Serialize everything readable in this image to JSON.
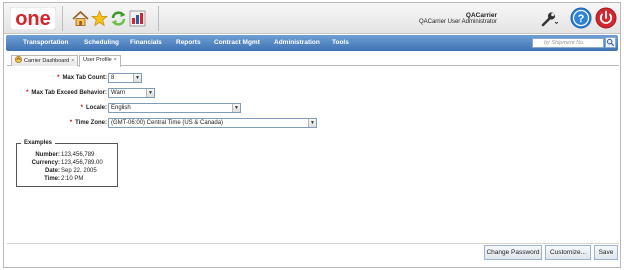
{
  "header": {
    "logo_text": "one",
    "user_name": "QACarrier",
    "user_role": "QACarrier User Administrator"
  },
  "nav": {
    "items": [
      "Transportation",
      "Scheduling",
      "Financials",
      "Reports",
      "Contract Mgmt",
      "Administration",
      "Tools"
    ],
    "search_placeholder": "by Shipment No."
  },
  "tabs": [
    {
      "label": "Carrier Dashboard",
      "close": "×"
    },
    {
      "label": "User Profile",
      "close": "×"
    }
  ],
  "form": {
    "max_tab_count": {
      "label": "Max Tab Count:",
      "value": "8"
    },
    "max_tab_exceed": {
      "label": "Max Tab Exceed Behavior:",
      "value": "Warn"
    },
    "locale": {
      "label": "Locale:",
      "value": "English"
    },
    "time_zone": {
      "label": "Time Zone:",
      "value": "(GMT-06:00) Central Time (US & Canada)"
    },
    "required_marker": "*"
  },
  "examples": {
    "legend": "Examples",
    "rows": [
      {
        "key": "Number:",
        "value": "123,456,789"
      },
      {
        "key": "Currency:",
        "value": "123,456,789.00"
      },
      {
        "key": "Date:",
        "value": "Sep 22, 2005"
      },
      {
        "key": "Time:",
        "value": "2:10 PM"
      }
    ]
  },
  "footer": {
    "change_password": "Change Password",
    "customize": "Customize...",
    "save": "Save"
  },
  "colors": {
    "nav_blue": "#3e72b2",
    "logo_red": "#d4262e",
    "required_red": "#d40000"
  }
}
